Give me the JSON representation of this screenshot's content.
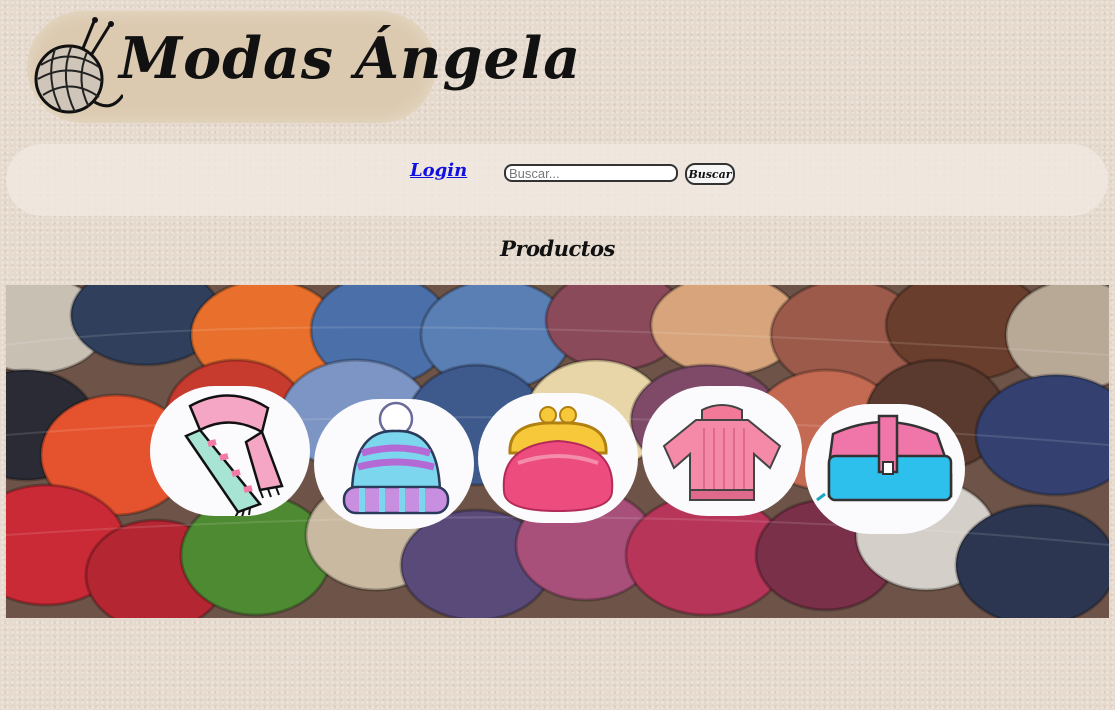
{
  "logo": {
    "text": "Modas Ángela",
    "icon": "yarn-ball-icon"
  },
  "nav": {
    "login_label": "Login",
    "search_placeholder": "Buscar...",
    "search_button": "Buscar"
  },
  "section_title": "Productos",
  "products": [
    {
      "icon": "scarf-icon"
    },
    {
      "icon": "beanie-icon"
    },
    {
      "icon": "coin-purse-icon"
    },
    {
      "icon": "sweater-icon"
    },
    {
      "icon": "handbag-icon"
    }
  ],
  "colors": {
    "page_background": "#e5dacd",
    "link": "#1010e0",
    "logo_background": "#dccab0"
  }
}
